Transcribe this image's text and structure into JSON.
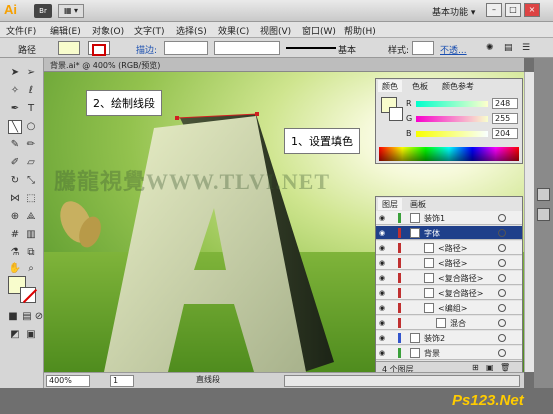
{
  "titlebar": {
    "app_logo": "Ai",
    "bridge_label": "Br",
    "arrange_label": "▦ ▾",
    "workspace": "基本功能 ▾"
  },
  "menu": [
    "文件(F)",
    "编辑(E)",
    "对象(O)",
    "文字(T)",
    "选择(S)",
    "效果(C)",
    "视图(V)",
    "窗口(W)",
    "帮助(H)"
  ],
  "control": {
    "selection_label": "路径",
    "stroke_label": "描边:",
    "stroke_preset": "基本",
    "style_label": "样式:",
    "opacity_label": "不透...",
    "fill_color": "#f8fccc"
  },
  "document": {
    "tab_title": "背景.ai* @ 400% (RGB/预览)",
    "zoom": "400%",
    "page": "1",
    "status": "直线段"
  },
  "callouts": {
    "draw_segment": "2、绘制线段",
    "set_fill": "1、设置填色"
  },
  "watermark": "騰龍視覺WWW.TLVI.NET",
  "color_panel": {
    "tabs": [
      "颜色",
      "色板",
      "颜色参考"
    ],
    "channels": [
      {
        "label": "R",
        "value": "248"
      },
      {
        "label": "G",
        "value": "255"
      },
      {
        "label": "B",
        "value": "204"
      }
    ]
  },
  "layers_panel": {
    "tabs": [
      "图层",
      "画板"
    ],
    "rows": [
      {
        "name": "装饰1",
        "type": "layer",
        "color": "#3ba03b"
      },
      {
        "name": "字体",
        "type": "layer",
        "color": "#c03030",
        "selected": true
      },
      {
        "name": "<路径>",
        "type": "item",
        "color": "#c03030"
      },
      {
        "name": "<路径>",
        "type": "item",
        "color": "#c03030"
      },
      {
        "name": "<复合路径>",
        "type": "item",
        "color": "#c03030"
      },
      {
        "name": "<复合路径>",
        "type": "item",
        "color": "#c03030"
      },
      {
        "name": "<编组>",
        "type": "item",
        "color": "#c03030"
      },
      {
        "name": "混合",
        "type": "subitem",
        "color": "#c03030"
      },
      {
        "name": "装饰2",
        "type": "layer",
        "color": "#3355cc"
      },
      {
        "name": "背景",
        "type": "layer",
        "color": "#3ba03b"
      }
    ],
    "footer": "4 个图层"
  },
  "site_logo": {
    "part1": "Ps123",
    "part2": ".Net"
  }
}
